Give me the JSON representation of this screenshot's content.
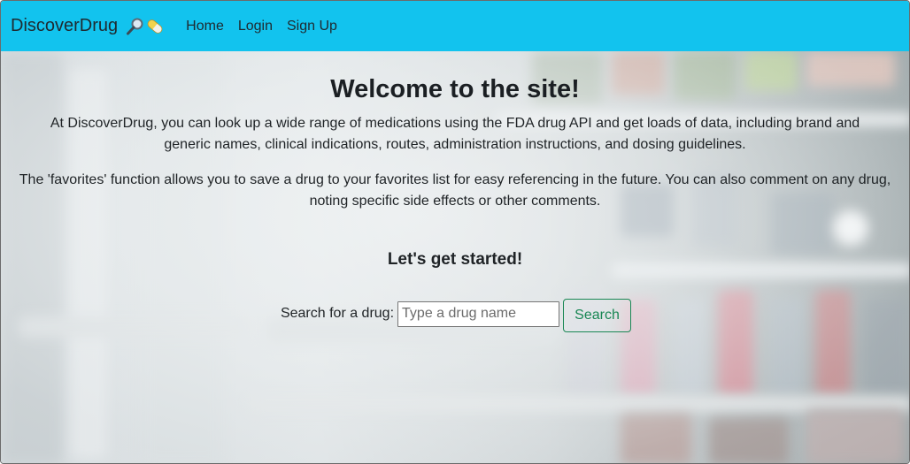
{
  "navbar": {
    "brand": "DiscoverDrug",
    "brand_icons": [
      "magnifier-icon",
      "pill-icon"
    ],
    "links": [
      {
        "label": "Home"
      },
      {
        "label": "Login"
      },
      {
        "label": "Sign Up"
      }
    ]
  },
  "main": {
    "title": "Welcome to the site!",
    "paragraph1": "At DiscoverDrug, you can look up a wide range of medications using the FDA drug API and get loads of data, including brand and generic names, clinical indications, routes, administration instructions, and dosing guidelines.",
    "paragraph2": "The 'favorites' function allows you to save a drug to your favorites list for easy referencing in the future. You can also comment on any drug, noting specific side effects or other comments.",
    "subtitle": "Let's get started!"
  },
  "search": {
    "label": "Search for a drug:",
    "placeholder": "Type a drug name",
    "value": "",
    "button_label": "Search"
  },
  "colors": {
    "navbar": "#12c3ee",
    "search_button": "#198754"
  }
}
